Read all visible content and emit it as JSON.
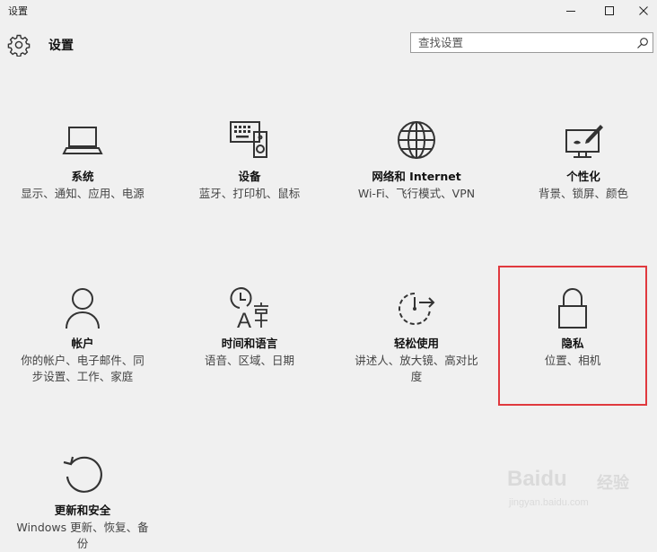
{
  "window": {
    "title": "设置",
    "controls": {
      "minimize_icon": "minimize-icon",
      "maximize_icon": "maximize-icon",
      "close_icon": "close-icon"
    }
  },
  "header": {
    "icon": "gear-icon",
    "title": "设置",
    "search": {
      "placeholder": "查找设置",
      "value": "",
      "icon": "search-icon"
    }
  },
  "tiles": [
    {
      "icon": "laptop-icon",
      "title": "系统",
      "desc": "显示、通知、应用、电源"
    },
    {
      "icon": "keyboard-speaker-icon",
      "title": "设备",
      "desc": "蓝牙、打印机、鼠标"
    },
    {
      "icon": "globe-icon",
      "title": "网络和 Internet",
      "desc": "Wi-Fi、飞行模式、VPN"
    },
    {
      "icon": "paint-screen-icon",
      "title": "个性化",
      "desc": "背景、锁屏、颜色"
    },
    {
      "icon": "person-icon",
      "title": "帐户",
      "desc": "你的帐户、电子邮件、同步设置、工作、家庭"
    },
    {
      "icon": "clock-language-icon",
      "title": "时间和语言",
      "desc": "语音、区域、日期"
    },
    {
      "icon": "ease-of-access-icon",
      "title": "轻松使用",
      "desc": "讲述人、放大镜、高对比度"
    },
    {
      "icon": "lock-icon",
      "title": "隐私",
      "desc": "位置、相机"
    },
    {
      "icon": "update-arrow-icon",
      "title": "更新和安全",
      "desc": "Windows 更新、恢复、备份"
    }
  ],
  "highlight_color": "#e0393e",
  "watermark": {
    "brand": "Baidu",
    "label": "经验",
    "url": "jingyan.baidu.com"
  }
}
